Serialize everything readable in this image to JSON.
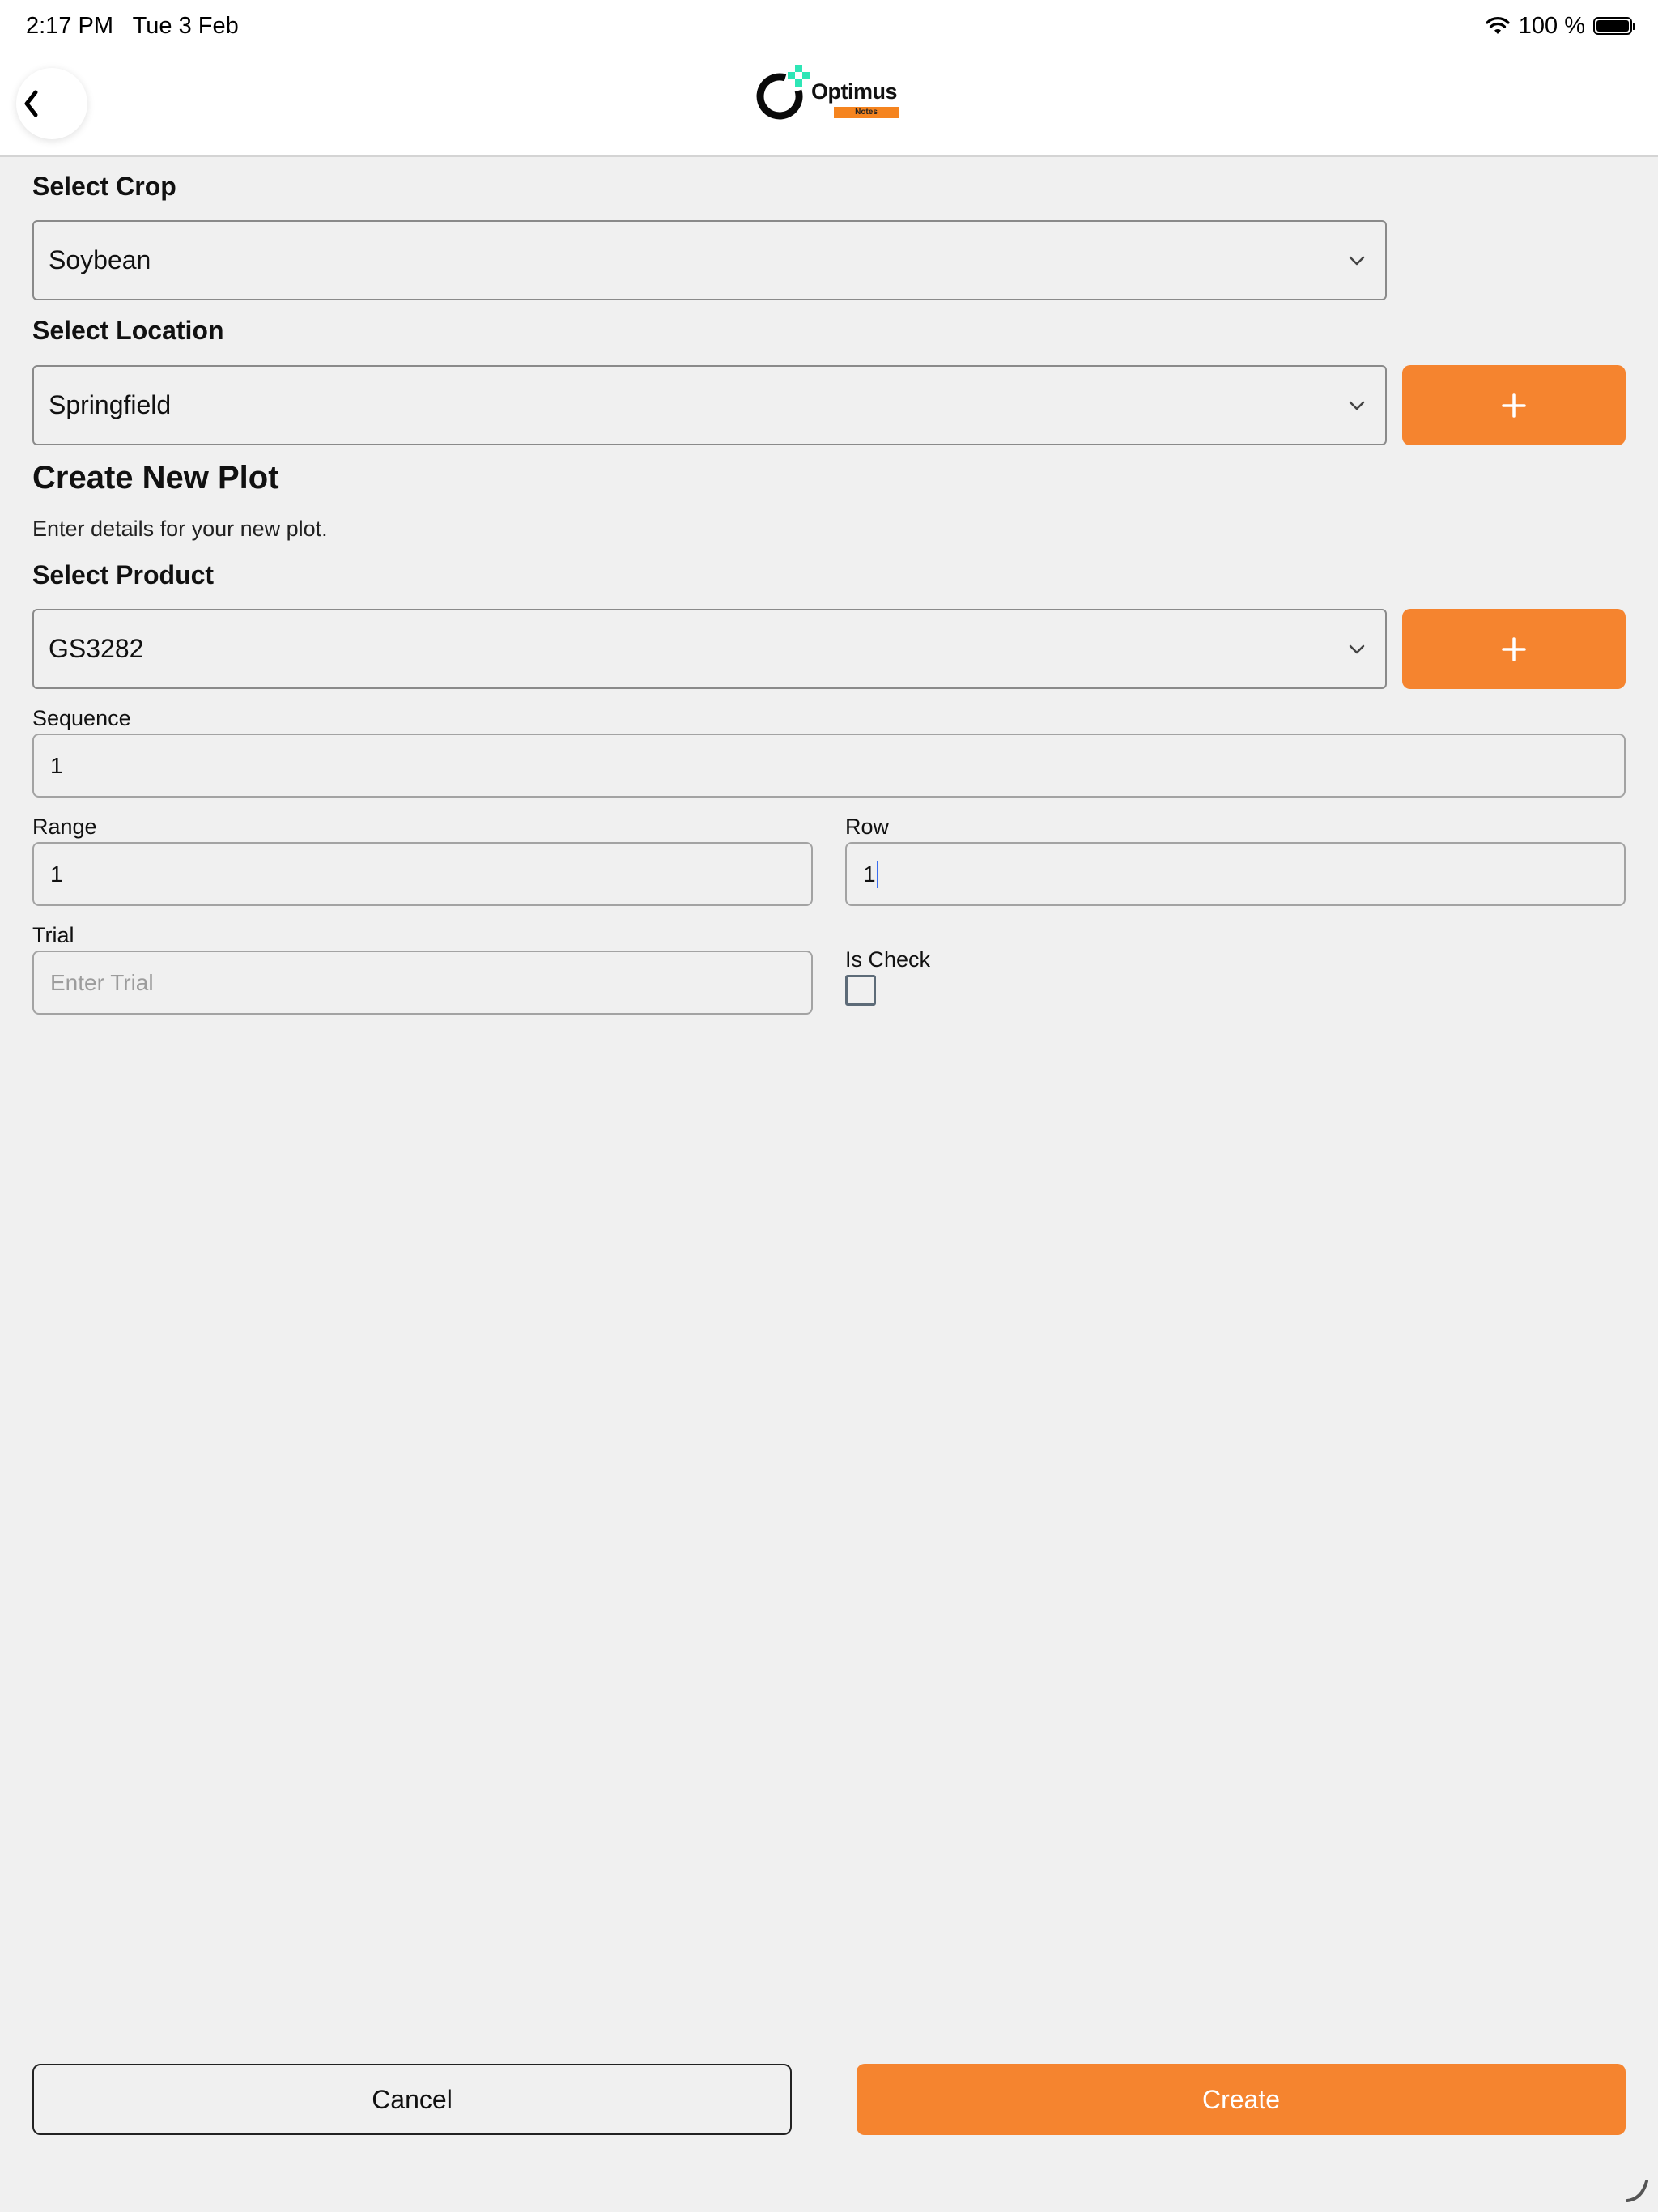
{
  "status_bar": {
    "time": "2:17 PM",
    "date": "Tue 3 Feb",
    "battery": "100 %",
    "icons": [
      "wifi-icon",
      "battery-icon"
    ]
  },
  "nav": {
    "back_icon": "chevron-left-icon",
    "logo": {
      "name": "Optimus",
      "tag": "Notes"
    }
  },
  "form": {
    "crop": {
      "label": "Select Crop",
      "value": "Soybean"
    },
    "location": {
      "label": "Select Location",
      "value": "Springfield",
      "add_symbol": "+"
    },
    "heading": "Create New Plot",
    "subtext": "Enter details for your new plot.",
    "product": {
      "label": "Select Product",
      "value": "GS3282",
      "add_symbol": "+"
    },
    "sequence": {
      "label": "Sequence",
      "value": "1"
    },
    "range": {
      "label": "Range",
      "value": "1"
    },
    "row": {
      "label": "Row",
      "value": "1"
    },
    "trial": {
      "label": "Trial",
      "value": "",
      "placeholder": "Enter Trial"
    },
    "is_check": {
      "label": "Is Check",
      "checked": false
    }
  },
  "actions": {
    "cancel": "Cancel",
    "create": "Create"
  },
  "colors": {
    "accent": "#f5842f",
    "background": "#f0f0f0",
    "logo_teal": "#2ee6b6"
  }
}
